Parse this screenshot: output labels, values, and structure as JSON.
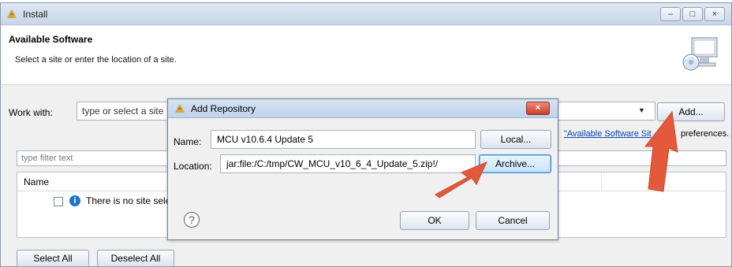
{
  "window": {
    "title": "Install",
    "heading": "Available Software",
    "subheading": "Select a site or enter the location of a site."
  },
  "main": {
    "work_with_label": "Work with:",
    "work_with_placeholder": "type or select a site",
    "add_button": "Add...",
    "available_software_sites_link": "\"Available Software Sit",
    "preferences_text": "preferences.",
    "filter_placeholder": "type filter text",
    "table": {
      "column_name": "Name",
      "row_text": "There is no site selected"
    },
    "select_all_button": "Select All",
    "deselect_all_button": "Deselect All"
  },
  "dialog": {
    "title": "Add Repository",
    "name_label": "Name:",
    "name_value": "MCU v10.6.4 Update 5",
    "local_button": "Local...",
    "location_label": "Location:",
    "location_value": "jar:file:/C:/tmp/CW_MCU_v10_6_4_Update_5.zip!/",
    "archive_button": "Archive...",
    "ok_button": "OK",
    "cancel_button": "Cancel"
  },
  "colors": {
    "accent_arrow": "#e4583b",
    "link": "#0645ad",
    "close_button": "#c6412b"
  }
}
